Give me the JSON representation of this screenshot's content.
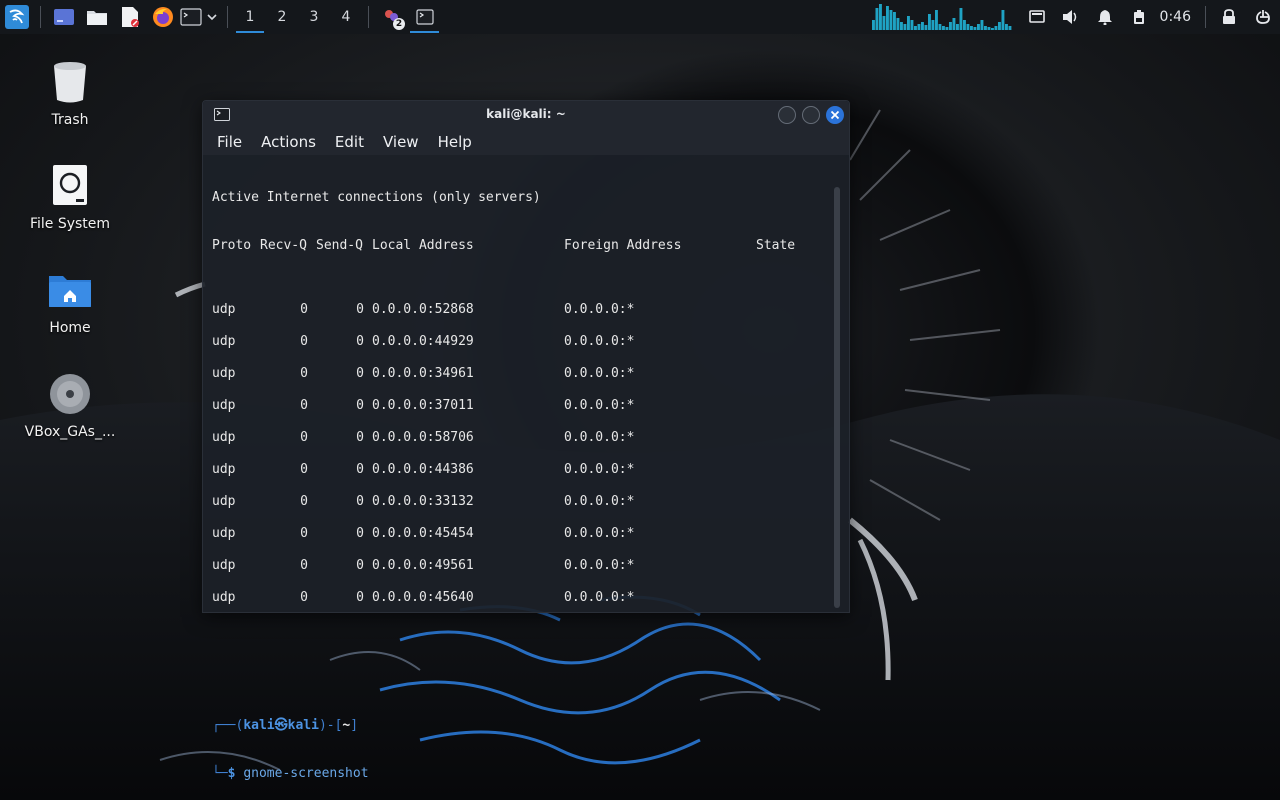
{
  "panel": {
    "workspaces": [
      "1",
      "2",
      "3",
      "4"
    ],
    "active_workspace_index": 0,
    "multi_window_badge": "2",
    "clock": "0:46",
    "accent": "#2f8bd8",
    "cpu_graph_color": "#1fa3c4"
  },
  "desktop": {
    "icons": [
      {
        "label": "Trash",
        "icon": "trash-icon"
      },
      {
        "label": "File System",
        "icon": "drive-icon"
      },
      {
        "label": "Home",
        "icon": "home-folder-icon"
      },
      {
        "label": "VBox_GAs_...",
        "icon": "optical-disc-icon"
      }
    ]
  },
  "terminal": {
    "title": "kali@kali: ~",
    "menu": [
      "File",
      "Actions",
      "Edit",
      "View",
      "Help"
    ],
    "header1": "Active Internet connections (only servers)",
    "columns": [
      "Proto",
      "Recv-Q",
      "Send-Q",
      "Local Address",
      "Foreign Address",
      "State"
    ],
    "rows": [
      {
        "proto": "udp",
        "recv_q": "0",
        "send_q": "0",
        "local": "0.0.0.0:52868",
        "foreign": "0.0.0.0:*"
      },
      {
        "proto": "udp",
        "recv_q": "0",
        "send_q": "0",
        "local": "0.0.0.0:44929",
        "foreign": "0.0.0.0:*"
      },
      {
        "proto": "udp",
        "recv_q": "0",
        "send_q": "0",
        "local": "0.0.0.0:34961",
        "foreign": "0.0.0.0:*"
      },
      {
        "proto": "udp",
        "recv_q": "0",
        "send_q": "0",
        "local": "0.0.0.0:37011",
        "foreign": "0.0.0.0:*"
      },
      {
        "proto": "udp",
        "recv_q": "0",
        "send_q": "0",
        "local": "0.0.0.0:58706",
        "foreign": "0.0.0.0:*"
      },
      {
        "proto": "udp",
        "recv_q": "0",
        "send_q": "0",
        "local": "0.0.0.0:44386",
        "foreign": "0.0.0.0:*"
      },
      {
        "proto": "udp",
        "recv_q": "0",
        "send_q": "0",
        "local": "0.0.0.0:33132",
        "foreign": "0.0.0.0:*"
      },
      {
        "proto": "udp",
        "recv_q": "0",
        "send_q": "0",
        "local": "0.0.0.0:45454",
        "foreign": "0.0.0.0:*"
      },
      {
        "proto": "udp",
        "recv_q": "0",
        "send_q": "0",
        "local": "0.0.0.0:49561",
        "foreign": "0.0.0.0:*"
      },
      {
        "proto": "udp",
        "recv_q": "0",
        "send_q": "0",
        "local": "0.0.0.0:45640",
        "foreign": "0.0.0.0:*"
      }
    ],
    "prompt": {
      "corner_top": "┌──",
      "user_host": "(kali㉿kali)",
      "dash": "-",
      "path": "[~]",
      "corner_bottom": "└─",
      "dollar": "$",
      "command": "gnome-screenshot"
    },
    "colors": {
      "prompt_blue": "#4c93e2",
      "close_button": "#2b73d9"
    }
  }
}
